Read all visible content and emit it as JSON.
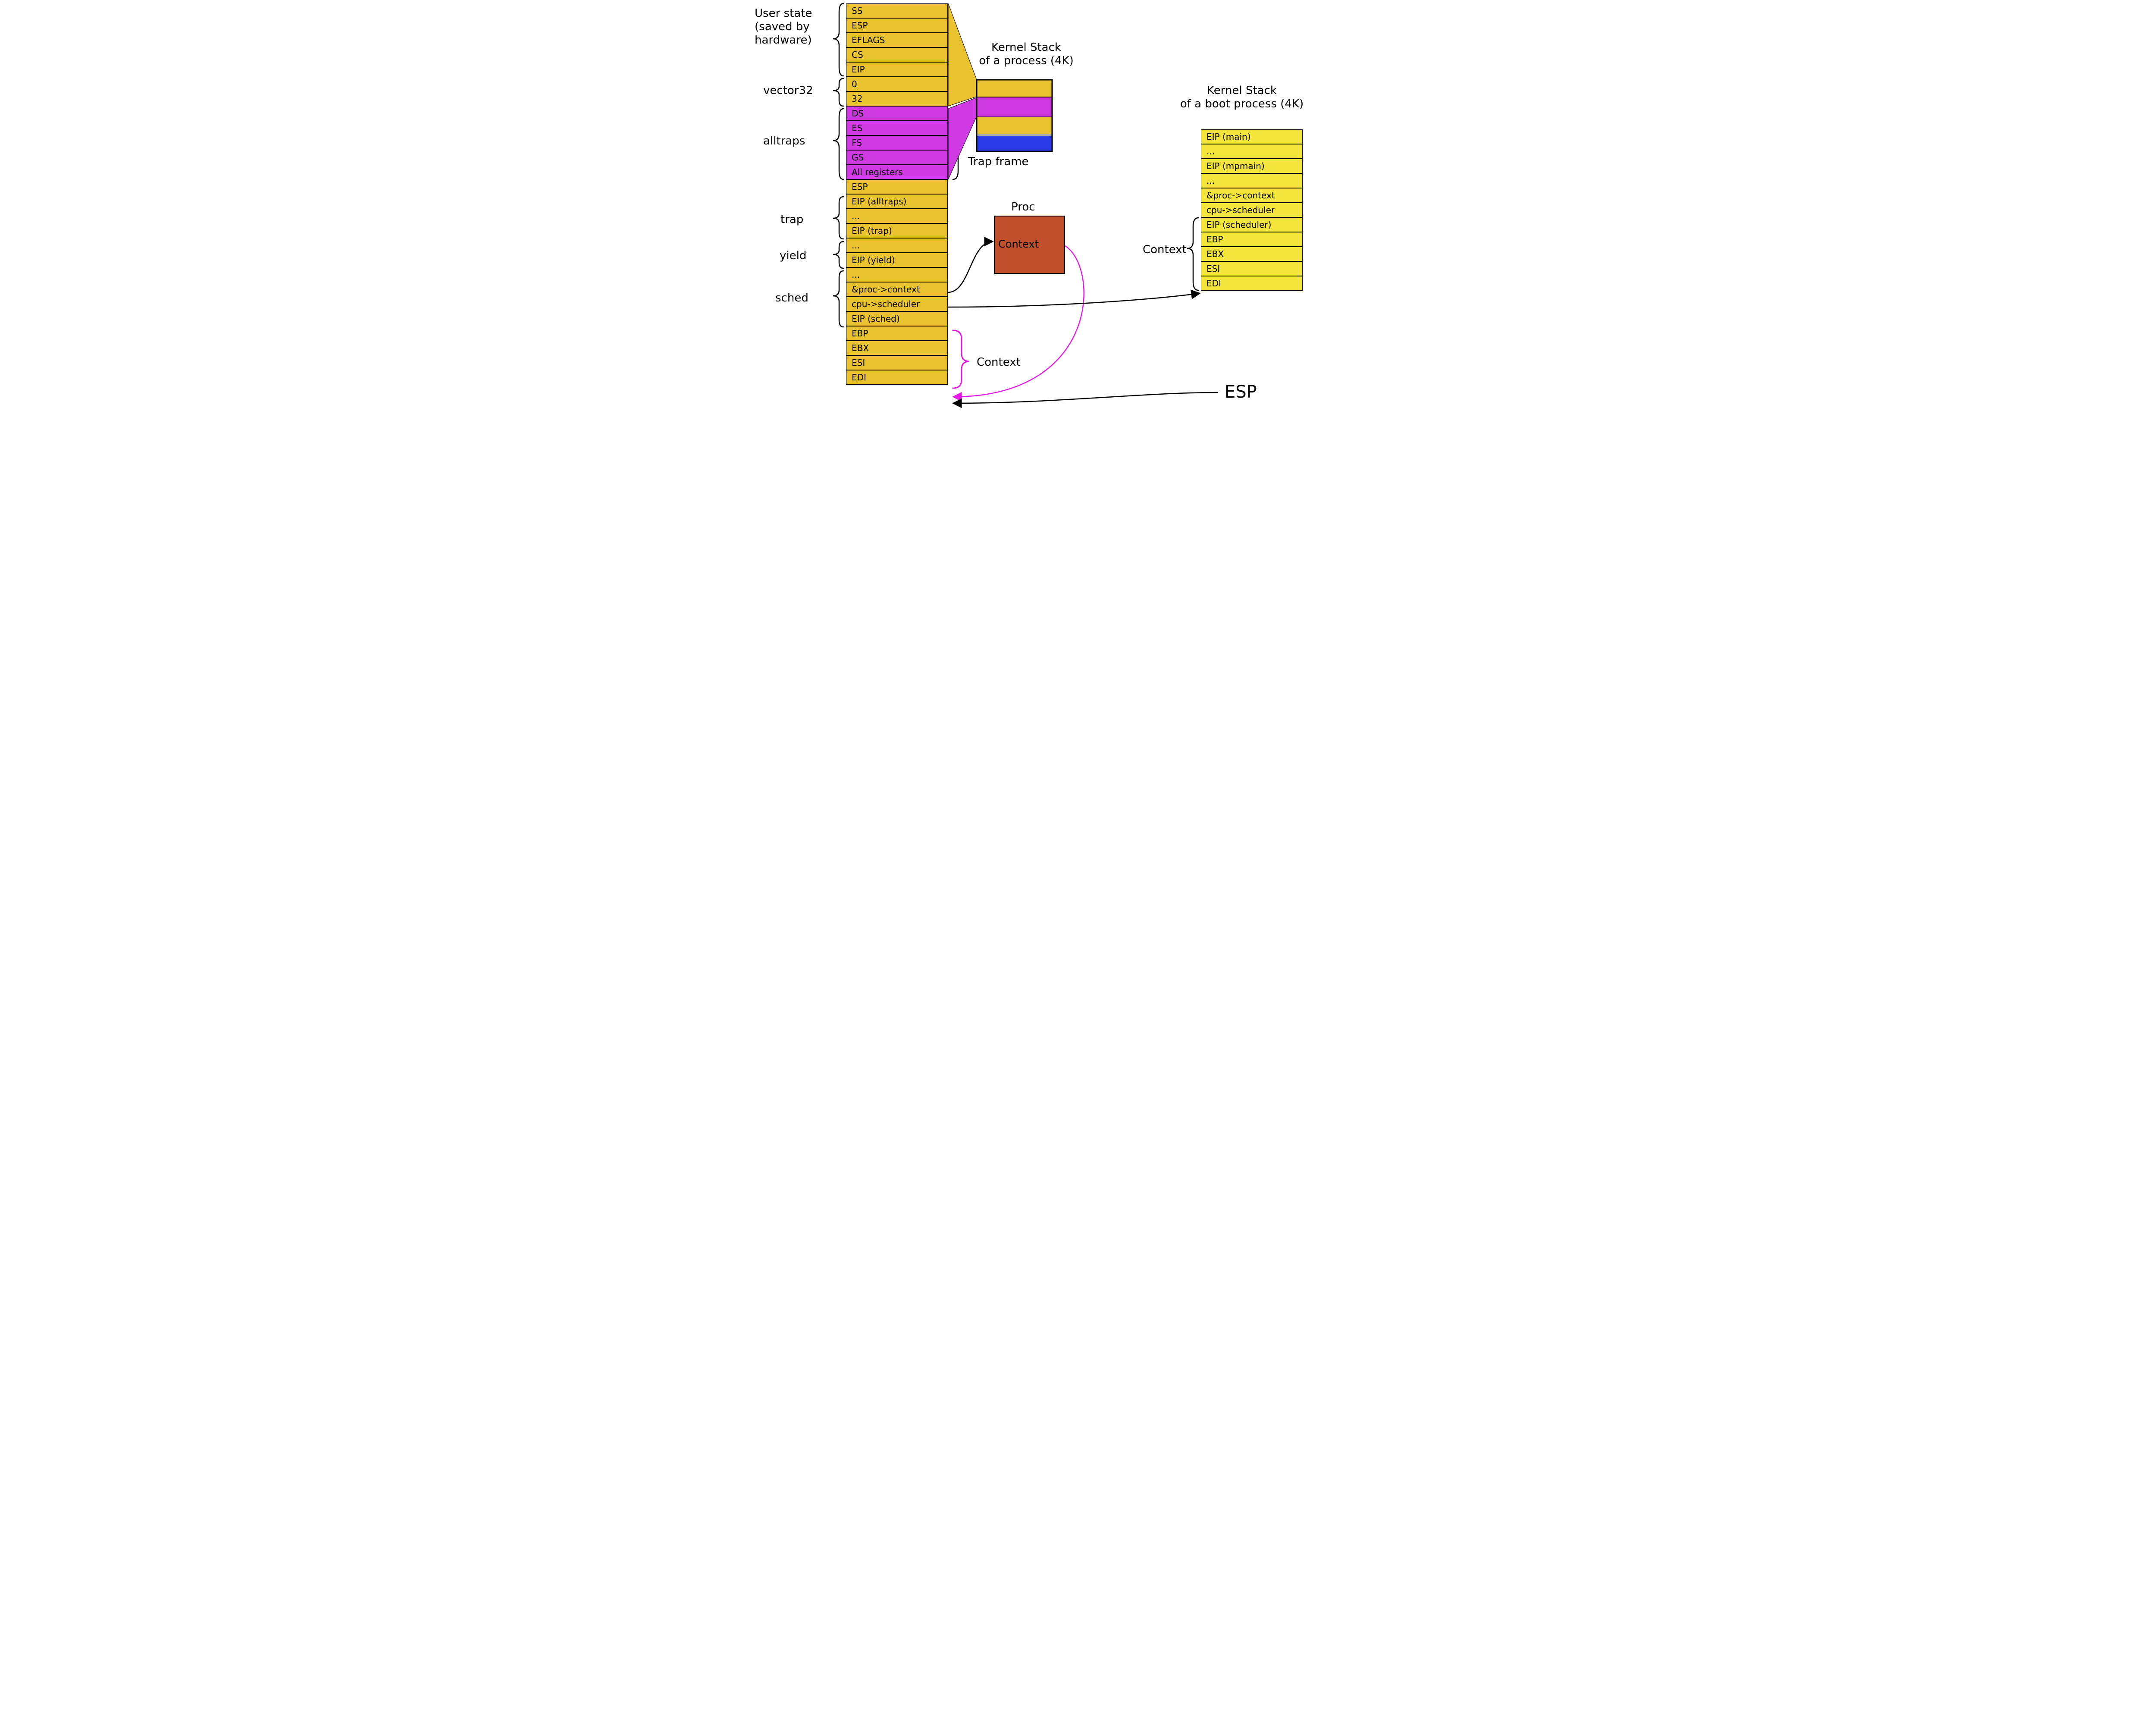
{
  "labels": {
    "user_state": "User state\n(saved by\nhardware)",
    "vector32": "vector32",
    "alltraps": "alltraps",
    "trap": "trap",
    "yield": "yield",
    "sched": "sched",
    "kstack_proc": "Kernel Stack\nof a process (4K)",
    "trap_frame": "Trap frame",
    "proc": "Proc",
    "context_proc": "Context",
    "context_main": "Context",
    "context_boot": "Context",
    "kstack_boot": "Kernel Stack\nof a boot process (4K)",
    "esp_big": "ESP"
  },
  "main_stack": [
    "SS",
    "ESP",
    "EFLAGS",
    "CS",
    "EIP",
    "0",
    "32",
    "DS",
    "ES",
    "FS",
    "GS",
    "All registers",
    "ESP",
    "EIP (alltraps)",
    "...",
    "EIP (trap)",
    "...",
    "EIP (yield)",
    "...",
    "&proc->context",
    "cpu->scheduler",
    "EIP (sched)",
    "EBP",
    "EBX",
    "ESI",
    "EDI"
  ],
  "main_colors": [
    "yellow",
    "yellow",
    "yellow",
    "yellow",
    "yellow",
    "yellow",
    "yellow",
    "magenta",
    "magenta",
    "magenta",
    "magenta",
    "magenta",
    "yellow",
    "yellow",
    "yellow",
    "yellow",
    "yellow",
    "yellow",
    "yellow",
    "yellow",
    "yellow",
    "yellow",
    "yellow",
    "yellow",
    "yellow",
    "yellow"
  ],
  "boot_stack": [
    "EIP (main)",
    "...",
    "EIP (mpmain)",
    "...",
    "&proc->context",
    "cpu->scheduler",
    "EIP (scheduler)",
    "EBP",
    "EBX",
    "ESI",
    "EDI"
  ]
}
